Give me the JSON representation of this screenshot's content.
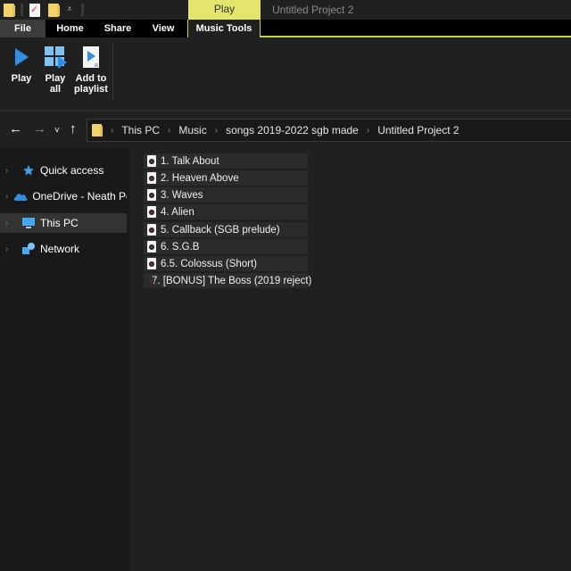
{
  "window": {
    "title": "Untitled Project 2",
    "context_tab": "Play"
  },
  "quick_access_toolbar": {
    "icons": [
      "folder-icon",
      "properties-check-icon",
      "new-folder-icon",
      "customize-dropdown-icon"
    ]
  },
  "ribbon": {
    "tabs": [
      {
        "label": "File",
        "active": false
      },
      {
        "label": "Home",
        "active": false
      },
      {
        "label": "Share",
        "active": false
      },
      {
        "label": "View",
        "active": false
      },
      {
        "label": "Music Tools",
        "active": true
      }
    ],
    "buttons": [
      {
        "label": "Play",
        "icon": "play-icon"
      },
      {
        "label_line1": "Play",
        "label_line2": "all",
        "icon": "play-all-icon"
      },
      {
        "label_line1": "Add to",
        "label_line2": "playlist",
        "icon": "add-to-playlist-icon"
      }
    ],
    "accent_color": "#e3e56c"
  },
  "navigation": {
    "back": "←",
    "forward": "→",
    "recent": "˅",
    "up": "↑",
    "breadcrumb": [
      "This PC",
      "Music",
      "songs 2019-2022 sgb made",
      "Untitled Project 2"
    ],
    "separator": "›"
  },
  "sidebar": {
    "items": [
      {
        "label": "Quick access",
        "icon": "star-icon",
        "selected": false
      },
      {
        "label": "OneDrive - Neath Por",
        "icon": "cloud-icon",
        "selected": false
      },
      {
        "label": "This PC",
        "icon": "monitor-icon",
        "selected": true
      },
      {
        "label": "Network",
        "icon": "network-icon",
        "selected": false
      }
    ],
    "chevron": "›"
  },
  "files": [
    {
      "name": "1. Talk About"
    },
    {
      "name": "2. Heaven Above"
    },
    {
      "name": "3. Waves"
    },
    {
      "name": "4. Alien"
    },
    {
      "name": "5. Callback (SGB prelude)"
    },
    {
      "name": "6. S.G.B"
    },
    {
      "name": "6.5. Colossus (Short)"
    },
    {
      "name": "7. [BONUS] The Boss (2019 reject)"
    }
  ]
}
